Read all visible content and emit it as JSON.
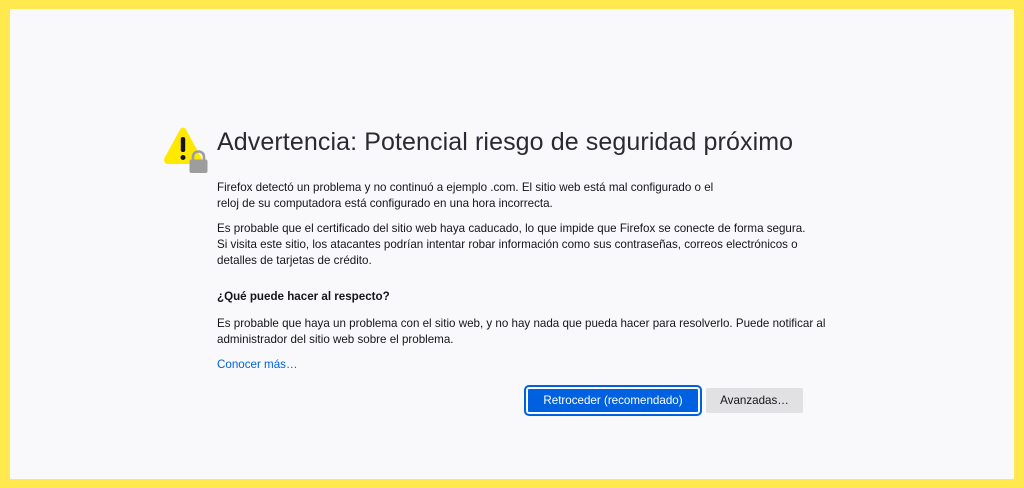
{
  "page": {
    "title": "Advertencia: Potencial riesgo de seguridad próximo",
    "paragraph1": "Firefox detectó un problema y no continuó a ejemplo .com. El sitio web está mal configurado o el reloj de su computadora está configurado en una hora incorrecta.",
    "paragraph2": "Es probable que el certificado del sitio web haya caducado, lo que impide que Firefox se conecte de forma segura. Si visita este sitio, los atacantes podrían intentar robar información como sus contraseñas, correos electrónicos o detalles de tarjetas de crédito.",
    "subheading": "¿Qué puede hacer al respecto?",
    "paragraph3": "Es probable que haya un problema con el sitio web, y no hay nada que pueda hacer para resolverlo. Puede notificar al administrador del sitio web sobre el problema.",
    "learn_more": "Conocer más…"
  },
  "buttons": {
    "go_back": "Retroceder (recomendado)",
    "advanced": "Avanzadas…"
  },
  "icons": {
    "warning": "warning-triangle-icon",
    "lock": "lock-icon"
  },
  "colors": {
    "border": "#ffe94e",
    "background": "#f9f9fb",
    "accent": "#0061e0",
    "warning": "#ffe900",
    "secondary_button": "#e1e1e4"
  }
}
